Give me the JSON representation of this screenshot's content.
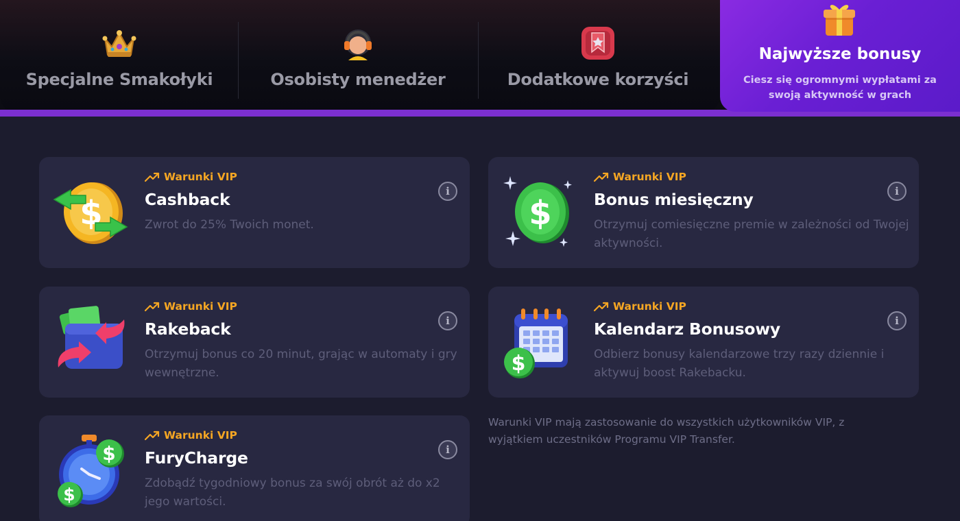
{
  "tabs": [
    {
      "label": "Specjalne Smakołyki",
      "icon": "crown-icon"
    },
    {
      "label": "Osobisty menedżer",
      "icon": "headset-icon"
    },
    {
      "label": "Dodatkowe korzyści",
      "icon": "badge-icon"
    }
  ],
  "active_tab": {
    "label": "Najwyższe bonusy",
    "description": "Ciesz się ogromnymi wypłatami za swoją aktywność w grach",
    "icon": "gift-icon"
  },
  "cards": [
    {
      "tag": "Warunki VIP",
      "title": "Cashback",
      "description": "Zwrot do 25% Twoich monet.",
      "icon": "cashback-coin-icon"
    },
    {
      "tag": "Warunki VIP",
      "title": "Bonus miesięczny",
      "description": "Otrzymuj comiesięczne premie w zależności od Twojej aktywności.",
      "icon": "dollar-coin-icon"
    },
    {
      "tag": "Warunki VIP",
      "title": "Rakeback",
      "description": "Otrzymuj bonus co 20 minut, grając w automaty i gry wewnętrzne.",
      "icon": "wallet-icon"
    },
    {
      "tag": "Warunki VIP",
      "title": "Kalendarz Bonusowy",
      "description": "Odbierz bonusy kalendarzowe trzy razy dziennie i aktywuj boost Rakebacku.",
      "icon": "calendar-icon"
    },
    {
      "tag": "Warunki VIP",
      "title": "FuryCharge",
      "description": "Zdobądź tygodniowy bonus za swój obrót aż do x2 jego wartości.",
      "icon": "stopwatch-icon"
    }
  ],
  "info_symbol": "i",
  "footnote": "Warunki VIP mają zastosowanie do wszystkich użytkowników VIP, z wyjątkiem uczestników Programu VIP Transfer.",
  "colors": {
    "background": "#1c1c2e",
    "card": "#282841",
    "accent_purple": "#7b2fd0",
    "tag_orange": "#f5a623",
    "muted_text": "#5e5e7a"
  }
}
